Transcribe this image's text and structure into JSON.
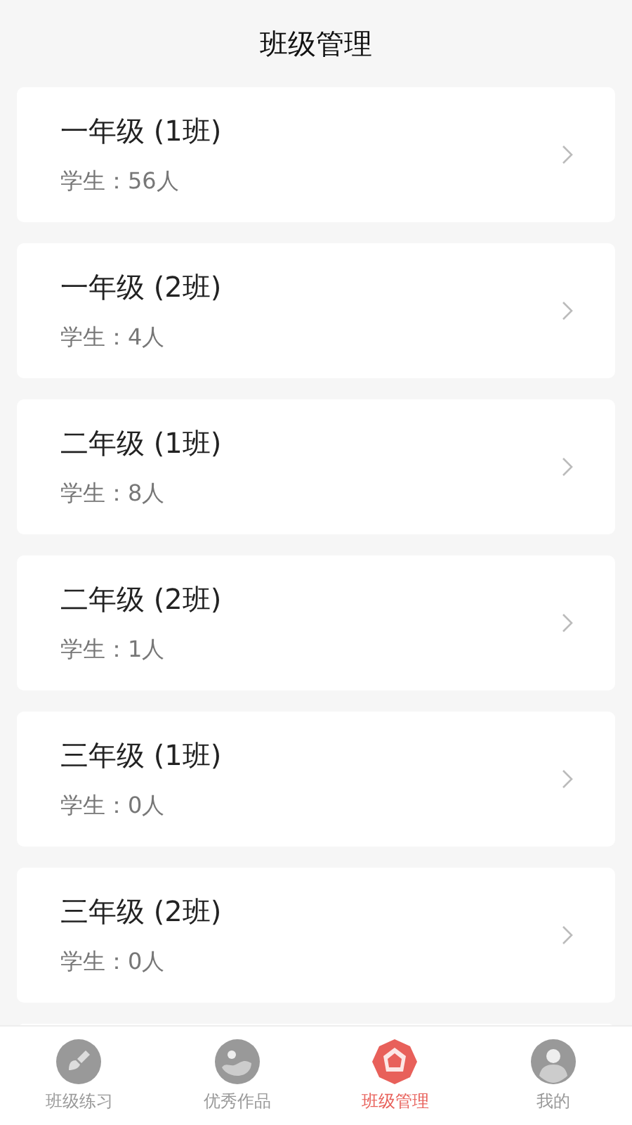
{
  "header": {
    "title": "班级管理"
  },
  "classes": [
    {
      "name": "一年级 (1班)",
      "students": "学生：56人"
    },
    {
      "name": "一年级 (2班)",
      "students": "学生：4人"
    },
    {
      "name": "二年级 (1班)",
      "students": "学生：8人"
    },
    {
      "name": "二年级 (2班)",
      "students": "学生：1人"
    },
    {
      "name": "三年级 (1班)",
      "students": "学生：0人"
    },
    {
      "name": "三年级 (2班)",
      "students": "学生：0人"
    }
  ],
  "tabs": [
    {
      "label": "班级练习",
      "kind": "brush",
      "selected": false
    },
    {
      "label": "优秀作品",
      "kind": "image",
      "selected": false
    },
    {
      "label": "班级管理",
      "kind": "class",
      "selected": true
    },
    {
      "label": "我的",
      "kind": "user",
      "selected": false
    }
  ]
}
